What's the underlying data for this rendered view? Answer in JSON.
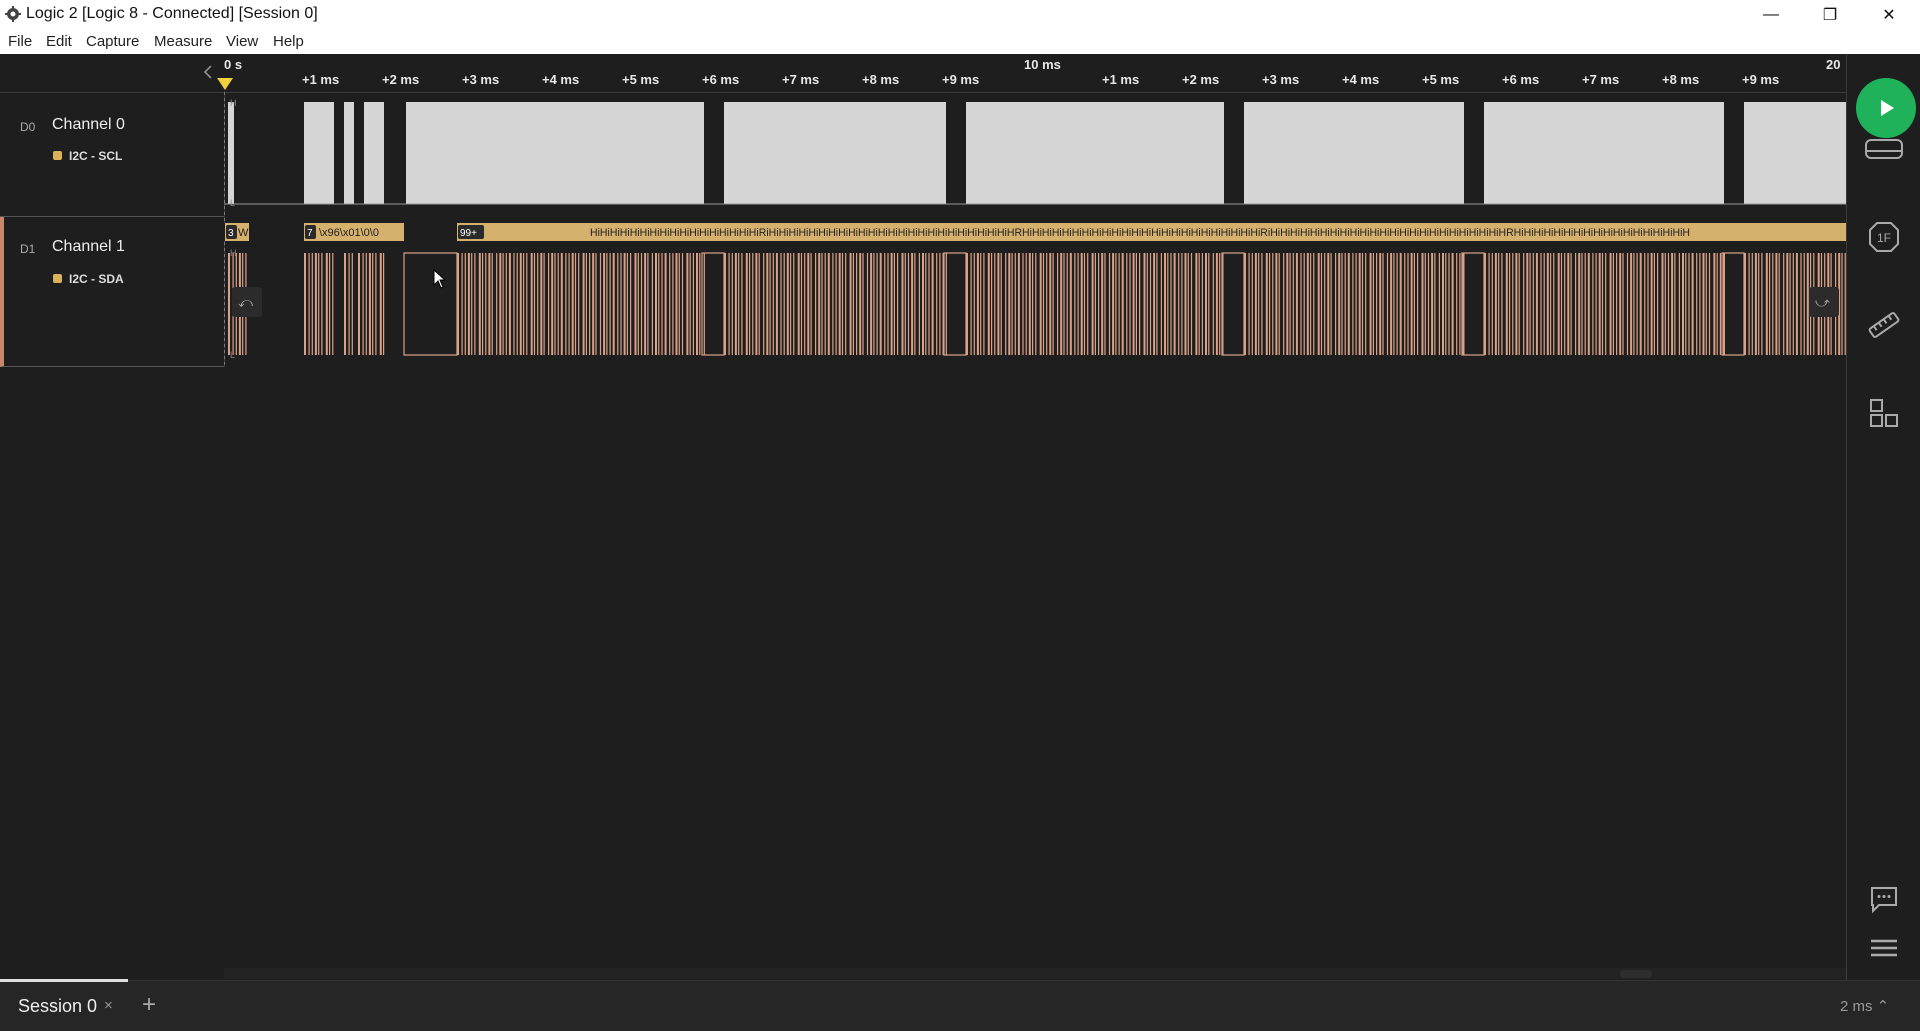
{
  "window": {
    "title": "Logic 2 [Logic 8 - Connected] [Session 0]",
    "minimize_glyph": "—",
    "maximize_glyph": "❐",
    "close_glyph": "✕"
  },
  "menu": {
    "items": [
      "File",
      "Edit",
      "Capture",
      "Measure",
      "View",
      "Help"
    ]
  },
  "timeline": {
    "start_label": "0 s",
    "mid_label": "10 ms",
    "end_label": "20",
    "ticks_first": [
      "+1 ms",
      "+2 ms",
      "+3 ms",
      "+4 ms",
      "+5 ms",
      "+6 ms",
      "+7 ms",
      "+8 ms",
      "+9 ms"
    ],
    "ticks_second": [
      "+1 ms",
      "+2 ms",
      "+3 ms",
      "+4 ms",
      "+5 ms",
      "+6 ms",
      "+7 ms",
      "+8 ms",
      "+9 ms"
    ]
  },
  "channels": [
    {
      "code": "D0",
      "name": "Channel 0",
      "analyzer": "I2C - SCL",
      "high_marker": "H",
      "low_marker": "L"
    },
    {
      "code": "D1",
      "name": "Channel 1",
      "analyzer": "I2C - SDA",
      "high_marker": "H",
      "low_marker": "L"
    }
  ],
  "decoder": {
    "frames": [
      {
        "badge": "3",
        "text": "W"
      },
      {
        "badge": "7",
        "text": "\\x96\\x01\\0\\0"
      },
      {
        "badge": "99+",
        "text": "HiHiHiHiHiHiHiHiHiHiHiHiHiHiHiHiHiRiHiHiHiHiHiHiHiHiHiHiHiHiHiHiHiHiHiHiHiHiHiHiHiHiHRHiHiHiHiHiHiHiHiHiHiHiHiHiHiHiHiHiHiHiHiHiHiHiHiRiHiHiHiHiHiHiHiHiHiHiHiHiHiHiHiHiHiHiHiHiHiHiHiHRHiHiHiHiHiHiHiHiHiHiHiHiHiHiHiHiHiH"
      }
    ]
  },
  "sidebar": {
    "buttons": [
      "play-icon",
      "device-icon",
      "analyzers-icon",
      "measure-icon",
      "extensions-icon",
      "comment-icon",
      "menu-icon"
    ]
  },
  "bottom": {
    "session_label": "Session 0",
    "close_glyph": "×",
    "add_glyph": "+",
    "zoom_label": "2 ms ⌃"
  },
  "colors": {
    "background": "#1e1e1e",
    "scl_fill": "#d6d6d6",
    "sda_fill": "#d9a288",
    "decoder_bar": "#d6b16e",
    "play": "#1fb25a",
    "channel1_accent": "#c8876a"
  }
}
